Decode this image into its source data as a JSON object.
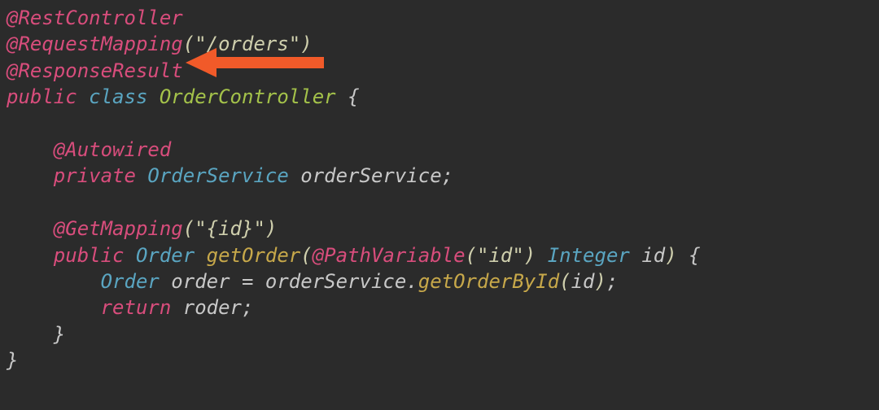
{
  "code": {
    "line1": {
      "anno": "@RestController"
    },
    "line2": {
      "anno": "@RequestMapping",
      "open": "(",
      "str": "\"/orders\"",
      "close": ")"
    },
    "line3": {
      "anno": "@ResponseResult"
    },
    "line4": {
      "kw_public": "public",
      "kw_class": "class",
      "classname": "OrderController",
      "brace": "{"
    },
    "line6": {
      "anno": "@Autowired"
    },
    "line7": {
      "kw_private": "private",
      "type": "OrderService",
      "ident": "orderService",
      "semi": ";"
    },
    "line9": {
      "anno": "@GetMapping",
      "open": "(",
      "str": "\"{id}\"",
      "close": ")"
    },
    "line10": {
      "kw_public": "public",
      "rettype": "Order",
      "method": "getOrder",
      "open": "(",
      "anno": "@PathVariable",
      "aopen": "(",
      "astr": "\"id\"",
      "aclose": ")",
      "ptype": "Integer",
      "pname": "id",
      "close": ")",
      "brace": "{"
    },
    "line11": {
      "type": "Order",
      "ident": "order",
      "eq": "=",
      "obj": "orderService",
      "dot": ".",
      "method": "getOrderById",
      "open": "(",
      "arg": "id",
      "close": ")",
      "semi": ";"
    },
    "line12": {
      "kw_return": "return",
      "ident": "roder",
      "semi": ";"
    },
    "line13": {
      "brace": "}"
    },
    "line14": {
      "brace": "}"
    }
  },
  "arrow": {
    "color": "#f15a29",
    "name": "callout-arrow-to-ResponseResult"
  }
}
